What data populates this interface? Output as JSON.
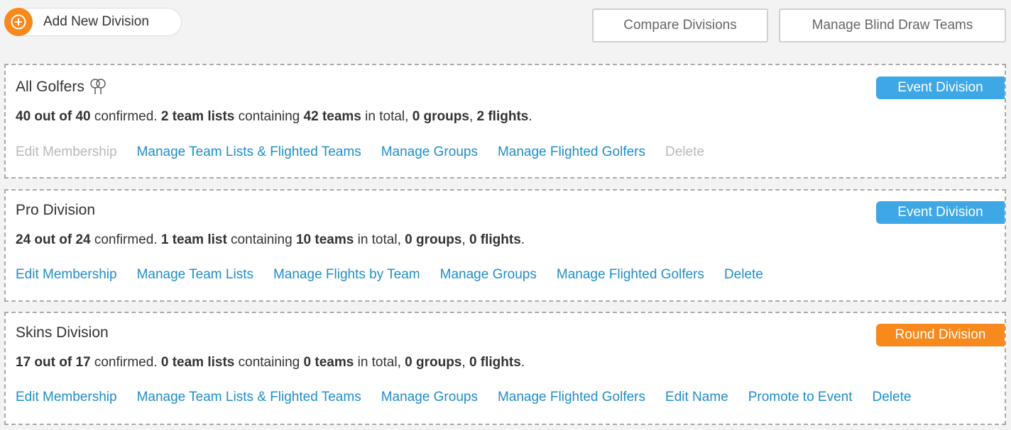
{
  "toolbar": {
    "add_label": "Add New Division",
    "compare_label": "Compare Divisions",
    "blind_draw_label": "Manage Blind Draw Teams"
  },
  "colors": {
    "accent_orange": "#f7891d",
    "event_blue": "#3ea7e6",
    "link_blue": "#1f8ec9"
  },
  "divisions": [
    {
      "name": "All Golfers",
      "icon": "trophy-icon",
      "badge": "Event Division",
      "summary": {
        "confirmed": "40 out of 40",
        "t1": " confirmed. ",
        "lists": "2 team lists",
        "t2": " containing ",
        "teams": "42 teams",
        "t3": " in total, ",
        "groups": "0 groups",
        "t4": ", ",
        "flights": "2 flights",
        "t5": "."
      },
      "links": [
        "Edit Membership",
        "Manage Team Lists & Flighted Teams",
        "Manage Groups",
        "Manage Flighted Golfers",
        "Delete"
      ]
    },
    {
      "name": "Pro Division",
      "badge": "Event Division",
      "summary": {
        "confirmed": "24 out of 24",
        "t1": " confirmed. ",
        "lists": "1 team list",
        "t2": " containing ",
        "teams": "10 teams",
        "t3": " in total, ",
        "groups": "0 groups",
        "t4": ", ",
        "flights": "0 flights",
        "t5": "."
      },
      "links": [
        "Edit Membership",
        "Manage Team Lists",
        "Manage Flights by Team",
        "Manage Groups",
        "Manage Flighted Golfers",
        "Delete"
      ]
    },
    {
      "name": "Skins Division",
      "badge": "Round Division",
      "summary": {
        "confirmed": "17 out of 17",
        "t1": " confirmed. ",
        "lists": "0 team lists",
        "t2": " containing ",
        "teams": "0 teams",
        "t3": " in total, ",
        "groups": "0 groups",
        "t4": ", ",
        "flights": "0 flights",
        "t5": "."
      },
      "links": [
        "Edit Membership",
        "Manage Team Lists & Flighted Teams",
        "Manage Groups",
        "Manage Flighted Golfers",
        "Edit Name",
        "Promote to Event",
        "Delete"
      ]
    }
  ]
}
